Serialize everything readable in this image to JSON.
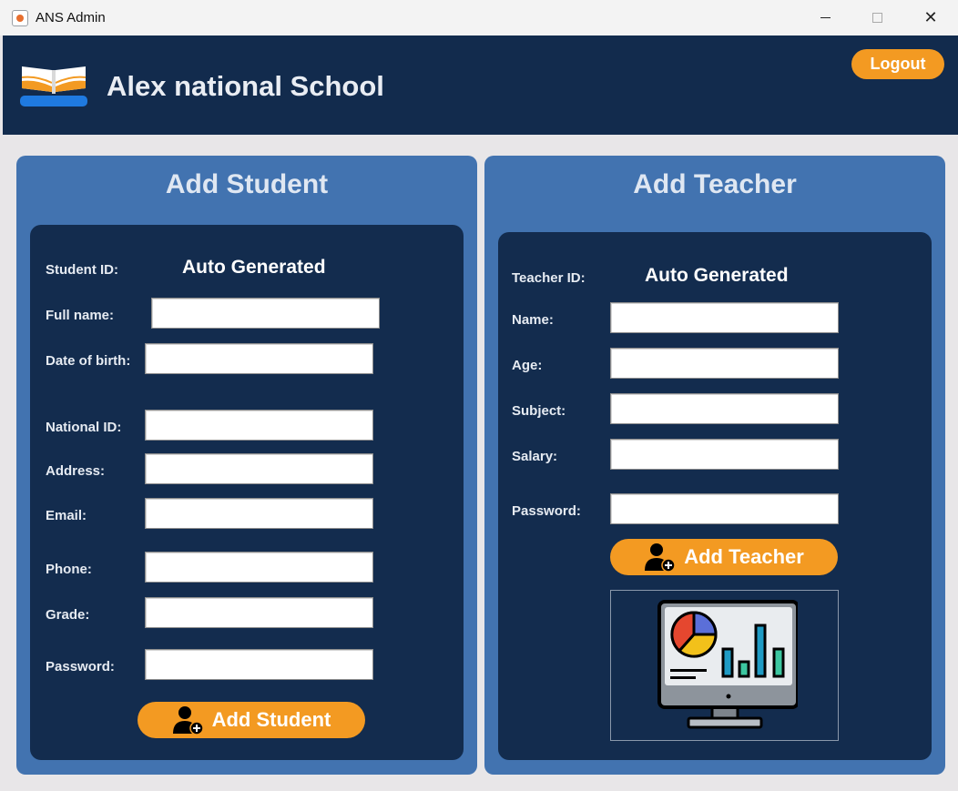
{
  "window": {
    "title": "ANS Admin",
    "controls": {
      "minimize": "",
      "maximize": "",
      "close": "✕"
    }
  },
  "header": {
    "school_name": "Alex national School",
    "logout_label": "Logout",
    "logo_icon": "open-book-icon"
  },
  "student_panel": {
    "title": "Add Student",
    "id_label": "Student ID:",
    "id_value": "Auto Generated",
    "fields": [
      {
        "label": "Full name:",
        "value": ""
      },
      {
        "label": "Date of birth:",
        "value": ""
      },
      {
        "label": "National ID:",
        "value": ""
      },
      {
        "label": "Address:",
        "value": ""
      },
      {
        "label": "Email:",
        "value": ""
      },
      {
        "label": "Phone:",
        "value": ""
      },
      {
        "label": "Grade:",
        "value": ""
      },
      {
        "label": "Password:",
        "value": ""
      }
    ],
    "submit_label": "Add Student",
    "submit_icon": "add-user-icon"
  },
  "teacher_panel": {
    "title": "Add Teacher",
    "id_label": "Teacher ID:",
    "id_value": "Auto Generated",
    "fields": [
      {
        "label": "Name:",
        "value": ""
      },
      {
        "label": "Age:",
        "value": ""
      },
      {
        "label": "Subject:",
        "value": ""
      },
      {
        "label": "Salary:",
        "value": ""
      },
      {
        "label": "Password:",
        "value": ""
      }
    ],
    "submit_label": "Add Teacher",
    "submit_icon": "add-user-icon",
    "illustration_icon": "analytics-monitor-icon"
  },
  "colors": {
    "header_bg": "#122b4d",
    "panel_bg": "#4273b0",
    "inner_bg": "#132c4e",
    "accent": "#f39a22"
  }
}
